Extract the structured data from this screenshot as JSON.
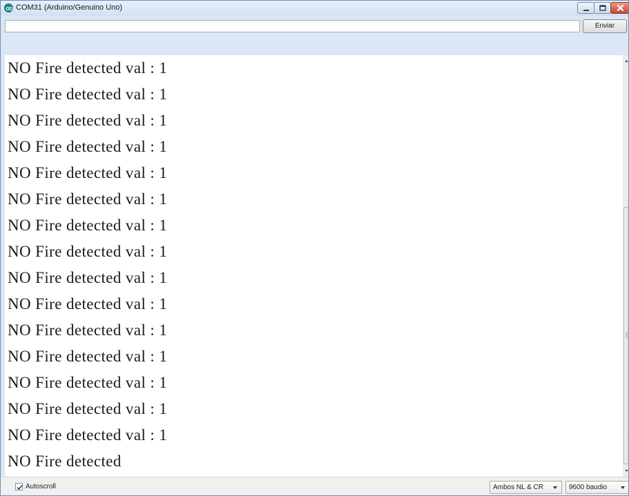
{
  "window": {
    "title": "COM31 (Arduino/Genuino Uno)",
    "icon": "arduino-logo-icon"
  },
  "controls": {
    "minimize_icon": "minimize-icon",
    "maximize_icon": "maximize-icon",
    "close_icon": "close-icon"
  },
  "input": {
    "value": "",
    "send_label": "Enviar"
  },
  "output": {
    "lines": [
      "NO Fire detected val : 1",
      "NO Fire detected val : 1",
      "NO Fire detected val : 1",
      "NO Fire detected val : 1",
      "NO Fire detected val : 1",
      "NO Fire detected val : 1",
      "NO Fire detected val : 1",
      "NO Fire detected val : 1",
      "NO Fire detected val : 1",
      "NO Fire detected val : 1",
      "NO Fire detected val : 1",
      "NO Fire detected val : 1",
      "NO Fire detected val : 1",
      "NO Fire detected val : 1",
      "NO Fire detected val : 1",
      "NO Fire detected"
    ]
  },
  "status": {
    "autoscroll_label": "Autoscroll",
    "autoscroll_checked": true,
    "line_ending": "Ambos NL & CR",
    "baud_rate": "9600 baudio"
  }
}
